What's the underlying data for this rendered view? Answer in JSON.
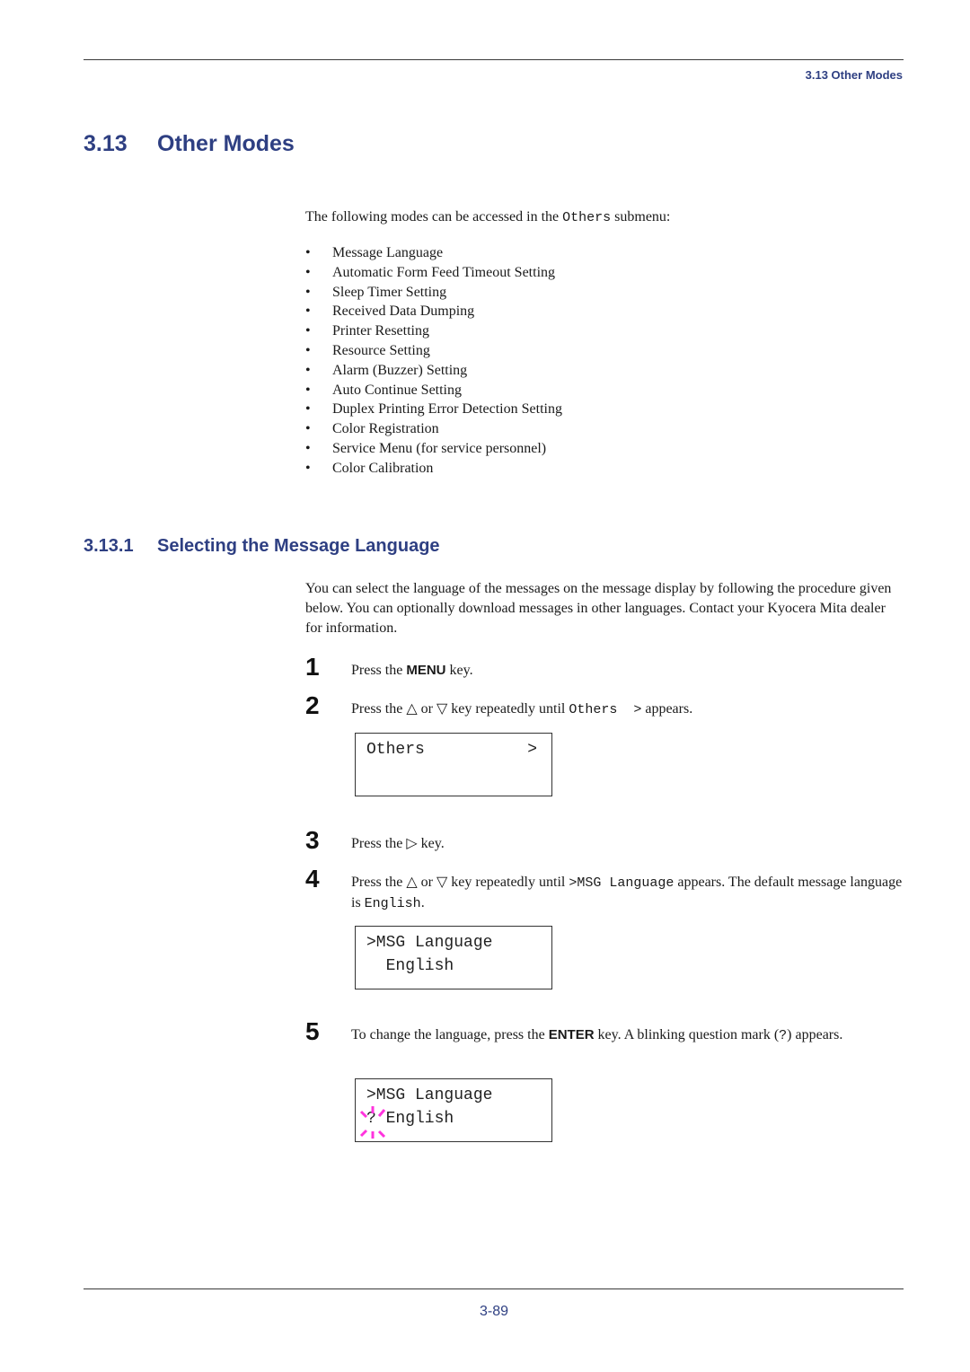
{
  "header": {
    "running_head": "3.13 Other Modes"
  },
  "section": {
    "number": "3.13",
    "title": "Other Modes",
    "intro_before": "The following modes can be accessed in the ",
    "intro_code": "Others",
    "intro_after": " submenu:",
    "bullet_glyph": "•",
    "modes": [
      "Message Language",
      "Automatic Form Feed Timeout Setting",
      "Sleep Timer Setting",
      "Received Data Dumping",
      "Printer Resetting",
      "Resource Setting",
      "Alarm (Buzzer) Setting",
      "Auto Continue Setting",
      "Duplex Printing Error Detection Setting",
      "Color Registration",
      "Service Menu (for service personnel)",
      "Color Calibration"
    ]
  },
  "subsection": {
    "number": "3.13.1",
    "title": "Selecting the Message Language",
    "paragraph": "You can select the language of the messages on the message display by following the procedure given below.  You can optionally download messages in other languages. Contact your Kyocera Mita dealer for information."
  },
  "steps": [
    {
      "num": "1",
      "before": "Press the ",
      "key": "MENU",
      "after": " key."
    },
    {
      "num": "2",
      "before": "Press the △ or ▽ key repeatedly until ",
      "code": "Others  >",
      "after": " appears."
    },
    {
      "num": "3",
      "before": "Press the ▷ key."
    },
    {
      "num": "4",
      "before": "Press the △ or ▽ key repeatedly until ",
      "code": ">MSG Language",
      "after": " appears. The default message language is ",
      "code2": "English",
      "after2": "."
    },
    {
      "num": "5",
      "before": "To change the language, press the ",
      "key": "ENTER",
      "after": " key. A blinking question mark (",
      "code": "?",
      "after2": ") appears."
    }
  ],
  "displays": [
    {
      "line1": "Others",
      "line1_right": ">",
      "line2": ""
    },
    {
      "line1": ">MSG Language",
      "line2": "  English"
    },
    {
      "line1": ">MSG Language",
      "line2": "? English",
      "blink_color": "#ff33dd"
    }
  ],
  "footer": {
    "page_number": "3-89"
  },
  "colors": {
    "heading": "#2e3f82",
    "blink": "#ff33dd"
  }
}
